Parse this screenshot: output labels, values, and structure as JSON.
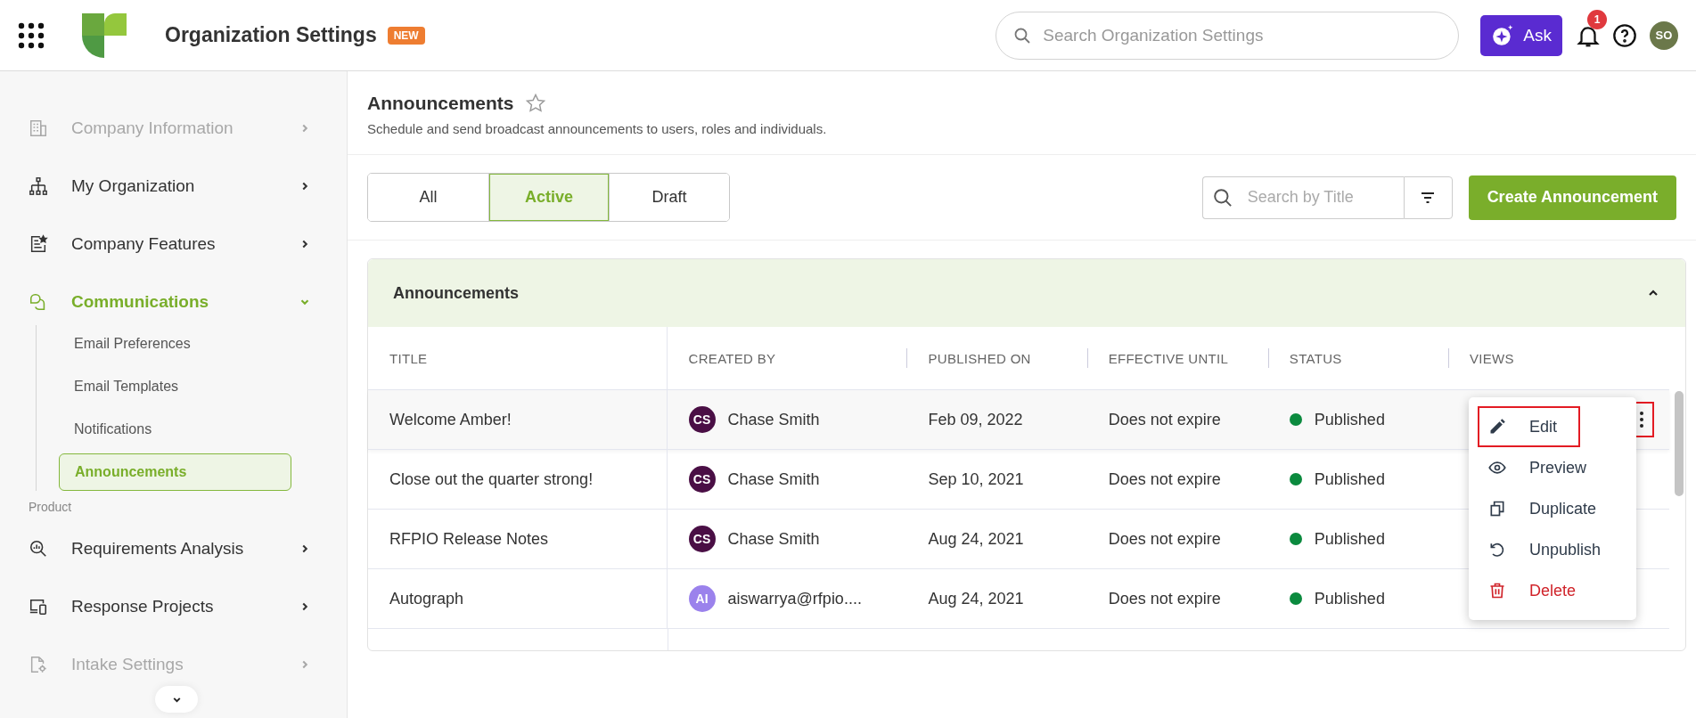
{
  "header": {
    "title": "Organization Settings",
    "badge": "NEW",
    "search": {
      "placeholder": "Search Organization Settings"
    },
    "ask_button": "Ask",
    "notifications_count": "1",
    "avatar": "SO"
  },
  "sidebar": {
    "items": [
      {
        "label": "Company Information",
        "disabled": true,
        "selected": false,
        "expanded": false
      },
      {
        "label": "My Organization",
        "disabled": false,
        "selected": false,
        "expanded": false
      },
      {
        "label": "Company Features",
        "disabled": false,
        "selected": false,
        "expanded": false
      },
      {
        "label": "Communications",
        "disabled": false,
        "selected": true,
        "expanded": true,
        "children": [
          {
            "label": "Email Preferences",
            "selected": false
          },
          {
            "label": "Email Templates",
            "selected": false
          },
          {
            "label": "Notifications",
            "selected": false
          },
          {
            "label": "Announcements",
            "selected": true
          }
        ]
      }
    ],
    "section": "Product",
    "section_items": [
      {
        "label": "Requirements Analysis",
        "disabled": false,
        "selected": false,
        "expanded": false
      },
      {
        "label": "Response Projects",
        "disabled": false,
        "selected": false,
        "expanded": false
      },
      {
        "label": "Intake Settings",
        "disabled": true,
        "selected": false,
        "expanded": false
      }
    ]
  },
  "page": {
    "title": "Announcements",
    "favorite": false,
    "description": "Schedule and send broadcast announcements to users, roles and individuals."
  },
  "tabs": [
    {
      "label": "All",
      "selected": false
    },
    {
      "label": "Active",
      "selected": true
    },
    {
      "label": "Draft",
      "selected": false
    }
  ],
  "search": {
    "placeholder": "Search by Title"
  },
  "create_button": "Create Announcement",
  "panel": {
    "title": "Announcements",
    "expanded": true
  },
  "table": {
    "columns": [
      "TITLE",
      "CREATED BY",
      "PUBLISHED ON",
      "EFFECTIVE UNTIL",
      "STATUS",
      "VIEWS"
    ],
    "rows": [
      {
        "title": "Welcome Amber!",
        "initials": "CS",
        "color": "#4a0f45",
        "created_by": "Chase Smith",
        "published_on": "Feb 09, 2022",
        "effective_until": "Does not expire",
        "status": "Published",
        "selected": true
      },
      {
        "title": "Close out the quarter strong!",
        "initials": "CS",
        "color": "#4a0f45",
        "created_by": "Chase Smith",
        "published_on": "Sep 10, 2021",
        "effective_until": "Does not expire",
        "status": "Published",
        "selected": false
      },
      {
        "title": "RFPIO Release Notes",
        "initials": "CS",
        "color": "#4a0f45",
        "created_by": "Chase Smith",
        "published_on": "Aug 24, 2021",
        "effective_until": "Does not expire",
        "status": "Published",
        "selected": false
      },
      {
        "title": "Autograph",
        "initials": "AI",
        "color": "#9b82ec",
        "created_by": "aiswarrya@rfpio....",
        "published_on": "Aug 24, 2021",
        "effective_until": "Does not expire",
        "status": "Published",
        "selected": false
      }
    ]
  },
  "row_menu": {
    "button_highlighted": true,
    "items": [
      {
        "label": "Edit",
        "kind": "normal",
        "highlighted": true
      },
      {
        "label": "Preview",
        "kind": "normal",
        "highlighted": false
      },
      {
        "label": "Duplicate",
        "kind": "normal",
        "highlighted": false
      },
      {
        "label": "Unpublish",
        "kind": "normal",
        "highlighted": false
      },
      {
        "label": "Delete",
        "kind": "danger",
        "highlighted": false
      }
    ]
  }
}
